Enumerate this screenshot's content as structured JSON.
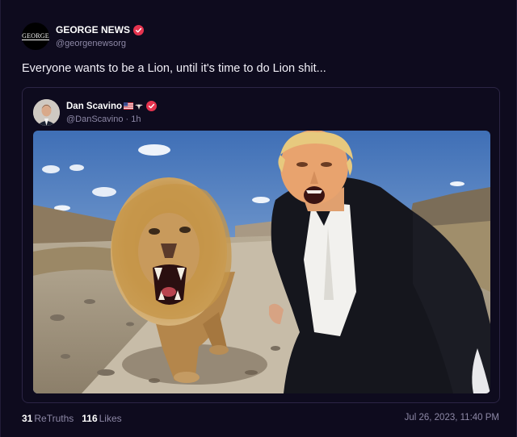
{
  "post": {
    "author": {
      "avatar_text": "GEORGE",
      "name": "GEORGE NEWS",
      "handle": "@georgenewsorg",
      "verified": true
    },
    "text": "Everyone wants to be a Lion, until it's time to do Lion shit...",
    "quoted": {
      "author": {
        "name": "Dan Scavino",
        "handle_time": "@DanScavino · 1h",
        "verified": true,
        "emoji_icons": [
          "us-flag-icon",
          "eagle-icon"
        ]
      },
      "image_alt": "Man in dark suit shouting beside a roaring lion on a desert dirt road"
    },
    "stats": {
      "retruths_count": "31",
      "retruths_label": "ReTruths",
      "likes_count": "116",
      "likes_label": "Likes"
    },
    "timestamp": "Jul 26, 2023, 11:40 PM"
  },
  "colors": {
    "background": "#0e0b1e",
    "verified_badge": "#e6344f",
    "muted_text": "#8d88a6",
    "card_border": "#2c2545"
  }
}
